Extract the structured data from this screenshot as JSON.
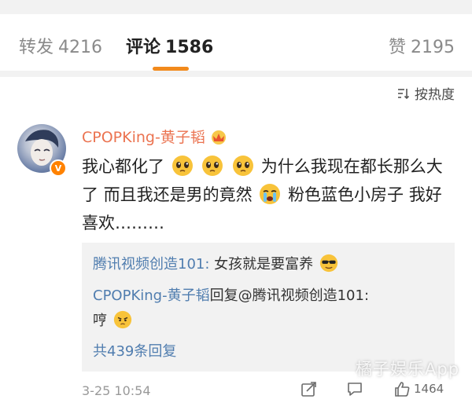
{
  "tabs": [
    {
      "label": "转发",
      "count": "4216"
    },
    {
      "label": "评论",
      "count": "1586"
    },
    {
      "label": "赞",
      "count": "2195"
    }
  ],
  "sort": {
    "label": "按热度"
  },
  "comment": {
    "username": "CPOPKing-黄子韬",
    "verified_badge": "V",
    "text_part1": "我心都化了",
    "text_part2": "为什么我现在都长那么大了 而且我还是男的竟然",
    "text_part3": " 粉色蓝色小房子 我好喜欢………",
    "timestamp": "3-25 10:54",
    "likes": "1464"
  },
  "replies": {
    "items": [
      {
        "author": "腾讯视频创造101:",
        "text": " 女孩就是要富养"
      },
      {
        "author": "CPOPKing-黄子韬",
        "text": "回复@腾讯视频创造101:"
      }
    ],
    "continued_text": "哼",
    "more_label": "共439条回复"
  },
  "watermark": "橘子娱乐App",
  "colors": {
    "accent": "#f28a1c",
    "username": "#eb7350",
    "link": "#507daf",
    "reply_bg": "#f2f2f2"
  }
}
